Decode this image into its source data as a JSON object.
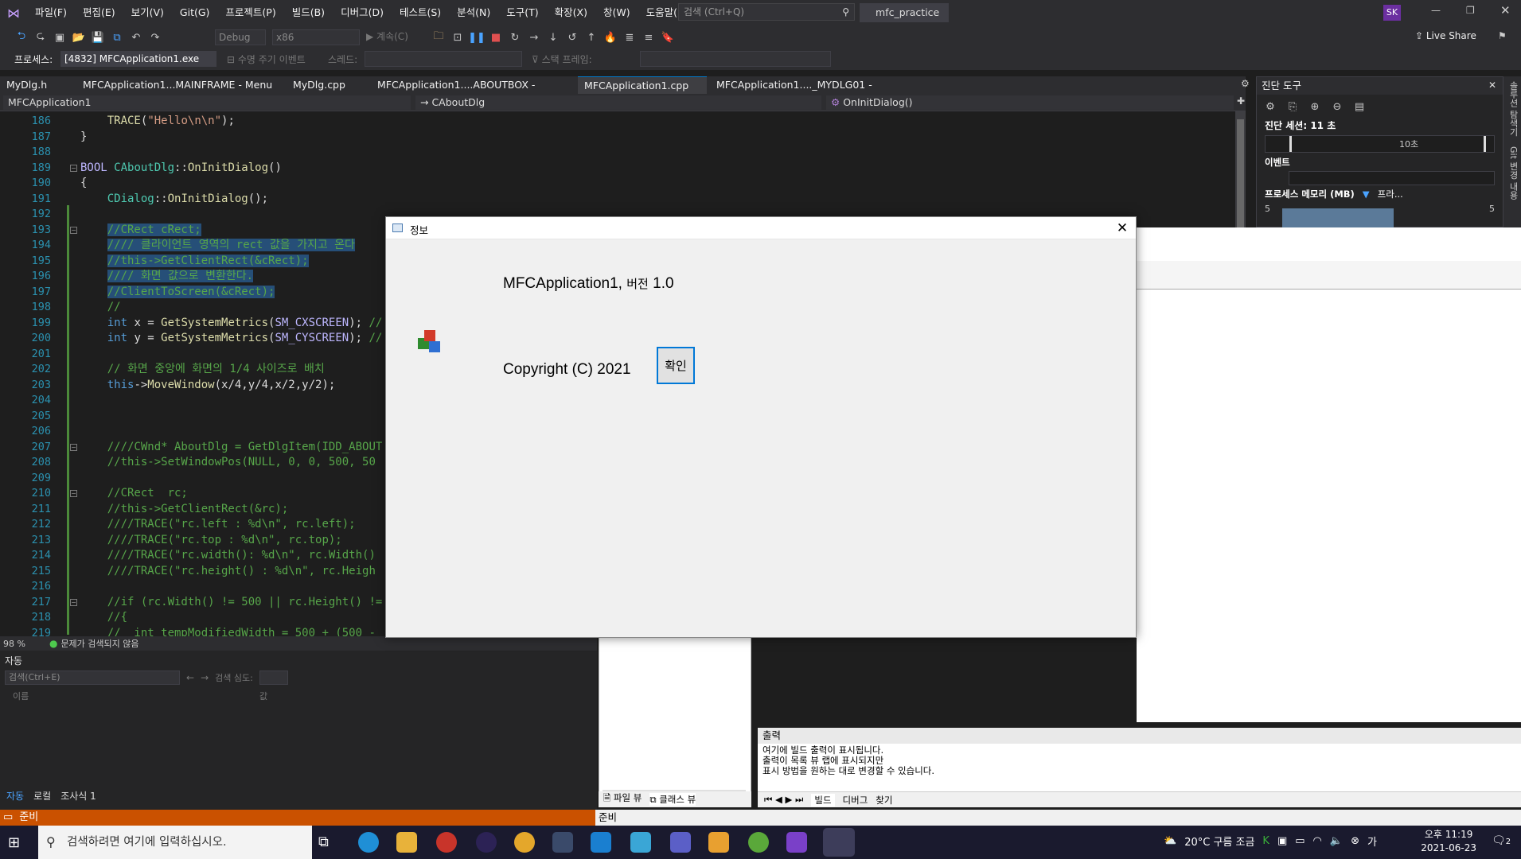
{
  "menu": [
    "파일(F)",
    "편집(E)",
    "보기(V)",
    "Git(G)",
    "프로젝트(P)",
    "빌드(B)",
    "디버그(D)",
    "테스트(S)",
    "분석(N)",
    "도구(T)",
    "확장(X)",
    "창(W)",
    "도움말(H)"
  ],
  "search_placeholder": "검색 (Ctrl+Q)",
  "project_name": "mfc_practice",
  "user_initials": "SK",
  "live_share": "Live Share",
  "toolbar": {
    "config": "Debug",
    "platform": "x86",
    "continue": "계속(C)"
  },
  "process_label": "프로세스:",
  "process_value": "[4832] MFCApplication1.exe",
  "lifecycle_label": "수명 주기 이벤트",
  "thread_label": "스레드:",
  "stack_label": "스택 프레임:",
  "tabs": [
    "MyDlg.h",
    "MFCApplication1...MAINFRAME - Menu",
    "MyDlg.cpp",
    "MFCApplication1....ABOUTBOX - Dialog",
    "MFCApplication1.cpp",
    "MFCApplication1...._MYDLG01 - Dialog"
  ],
  "nav": {
    "project": "MFCApplication1",
    "class": "CAboutDlg",
    "method": "OnInitDialog()"
  },
  "diag": {
    "title": "진단 도구",
    "session": "진단 세션: 11 초",
    "tick": "10초",
    "events": "이벤트",
    "memory": "프로세스 메모리 (MB)",
    "private": "프라...",
    "max_left": "5",
    "max_right": "5"
  },
  "vtabs": [
    "솔루션 탐색기",
    "Git 변경 내용"
  ],
  "code_lines": [
    {
      "n": "186",
      "html": "    <span class='fn'>TRACE</span>(<span class='st'>\"Hello\\n\\n\"</span>);"
    },
    {
      "n": "187",
      "html": "}"
    },
    {
      "n": "188",
      "html": ""
    },
    {
      "n": "189",
      "html": "<span class='mc'>BOOL</span> <span class='ty'>CAboutDlg</span>::<span class='fn'>OnInitDialog</span>()"
    },
    {
      "n": "190",
      "html": "{"
    },
    {
      "n": "191",
      "html": "    <span class='ty'>CDialog</span>::<span class='fn'>OnInitDialog</span>();"
    },
    {
      "n": "192",
      "html": ""
    },
    {
      "n": "193",
      "html": "    <span class='cm sel'>//CRect cRect;</span>"
    },
    {
      "n": "194",
      "html": "    <span class='cm sel'>//// 클라이언트 영역의 rect 값을 가지고 온다</span>"
    },
    {
      "n": "195",
      "html": "    <span class='cm sel'>//this->GetClientRect(&amp;cRect);</span>"
    },
    {
      "n": "196",
      "html": "    <span class='cm sel'>//// 화면 값으로 변환한다.</span>"
    },
    {
      "n": "197",
      "html": "    <span class='cm sel'>//ClientToScreen(&amp;cRect);</span>"
    },
    {
      "n": "198",
      "html": "    <span class='cm'>//</span>"
    },
    {
      "n": "199",
      "html": "    <span class='kw'>int</span> x = <span class='fn'>GetSystemMetrics</span>(<span class='mc'>SM_CXSCREEN</span>); <span class='cm'>//</span>"
    },
    {
      "n": "200",
      "html": "    <span class='kw'>int</span> y = <span class='fn'>GetSystemMetrics</span>(<span class='mc'>SM_CYSCREEN</span>); <span class='cm'>//</span>"
    },
    {
      "n": "201",
      "html": ""
    },
    {
      "n": "202",
      "html": "    <span class='cm'>// 화면 중앙에 화면의 1/4 사이즈로 배치</span>"
    },
    {
      "n": "203",
      "html": "    <span class='kw'>this</span>-><span class='fn'>MoveWindow</span>(x/4,y/4,x/2,y/2);"
    },
    {
      "n": "204",
      "html": ""
    },
    {
      "n": "205",
      "html": ""
    },
    {
      "n": "206",
      "html": ""
    },
    {
      "n": "207",
      "html": "    <span class='cm'>////CWnd* AboutDlg = GetDlgItem(IDD_ABOUT</span>"
    },
    {
      "n": "208",
      "html": "    <span class='cm'>//this->SetWindowPos(NULL, 0, 0, 500, 50</span>"
    },
    {
      "n": "209",
      "html": ""
    },
    {
      "n": "210",
      "html": "    <span class='cm'>//CRect  rc;</span>"
    },
    {
      "n": "211",
      "html": "    <span class='cm'>//this->GetClientRect(&amp;rc);</span>"
    },
    {
      "n": "212",
      "html": "    <span class='cm'>////TRACE(\"rc.left : %d\\n\", rc.left);</span>"
    },
    {
      "n": "213",
      "html": "    <span class='cm'>////TRACE(\"rc.top : %d\\n\", rc.top);</span>"
    },
    {
      "n": "214",
      "html": "    <span class='cm'>////TRACE(\"rc.width(): %d\\n\", rc.Width()</span>"
    },
    {
      "n": "215",
      "html": "    <span class='cm'>////TRACE(\"rc.height() : %d\\n\", rc.Heigh</span>"
    },
    {
      "n": "216",
      "html": ""
    },
    {
      "n": "217",
      "html": "    <span class='cm'>//if (rc.Width() != 500 || rc.Height() !=</span>"
    },
    {
      "n": "218",
      "html": "    <span class='cm'>//{</span>"
    },
    {
      "n": "219",
      "html": "    <span class='cm'>//  int tempModifiedWidth = 500 + (500 -</span>"
    }
  ],
  "status": {
    "zoom": "98 %",
    "issues": "문제가 검색되지 않음",
    "ready": "준비"
  },
  "auto_panel": {
    "title": "자동",
    "search": "검색(Ctrl+E)",
    "depth": "검색 심도:",
    "col_name": "이름",
    "col_value": "값",
    "tabs": [
      "자동",
      "로컬",
      "조사식 1"
    ]
  },
  "classview_tabs": [
    "파일 뷰",
    "클래스 뷰"
  ],
  "output": {
    "title": "출력",
    "lines": [
      "여기에 빌드 출력이 표시됩니다.",
      "출력이 목록 뷰 랩에 표시되지만",
      "표시 방법을 원하는 대로 변경할 수 있습니다."
    ],
    "tabs": [
      "빌드",
      "디버그",
      "찾기"
    ]
  },
  "dialog": {
    "title": "정보",
    "version_app": "MFCApplication1,",
    "version_word": "버전",
    "version_num": "1.0",
    "copyright": "Copyright (C) 2021",
    "ok": "확인"
  },
  "taskbar": {
    "search": "검색하려면 여기에 입력하십시오.",
    "weather": "20°C 구름 조금",
    "time": "오후 11:19",
    "date": "2021-06-23",
    "notif": "2"
  }
}
